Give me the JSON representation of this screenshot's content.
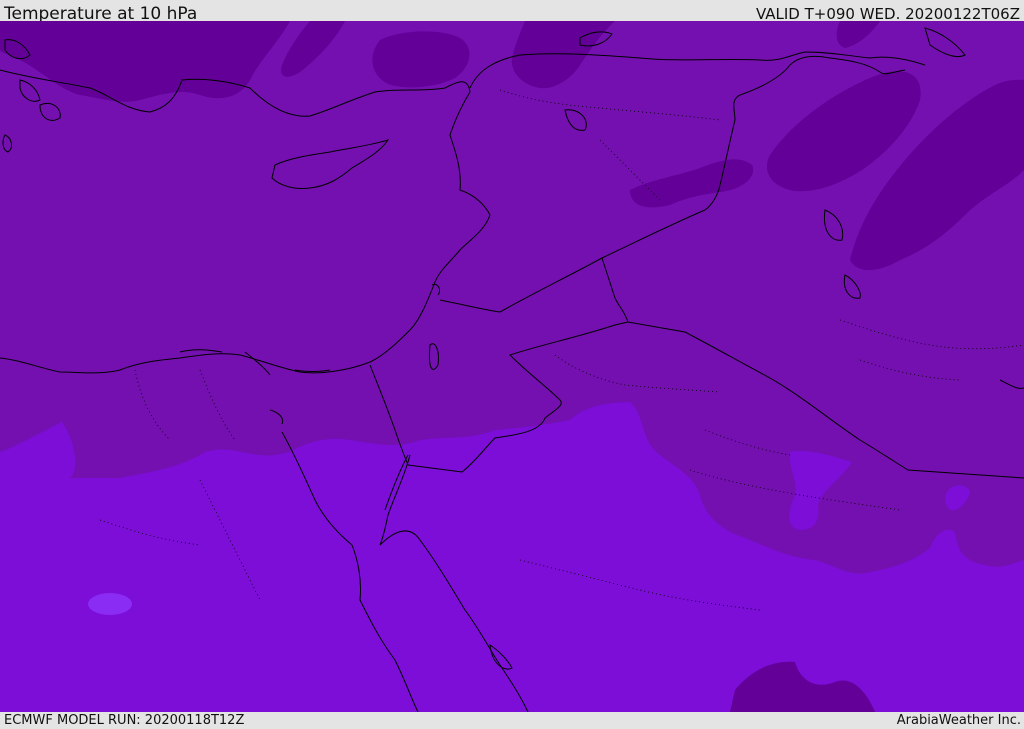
{
  "header": {
    "title": "Temperature at 10 hPa",
    "valid_time": "VALID T+090 WED. 20200122T06Z"
  },
  "footer": {
    "model_run": "ECMWF MODEL RUN: 20200118T12Z",
    "credit": "ArabiaWeather Inc."
  },
  "map": {
    "field": "Temperature",
    "level": "10 hPa",
    "colors": {
      "coldest": "#620098",
      "cold": "#7410b0",
      "cool": "#7c0ed8",
      "warm_patch": "#8a2cf4",
      "boundary": "#000000"
    }
  }
}
